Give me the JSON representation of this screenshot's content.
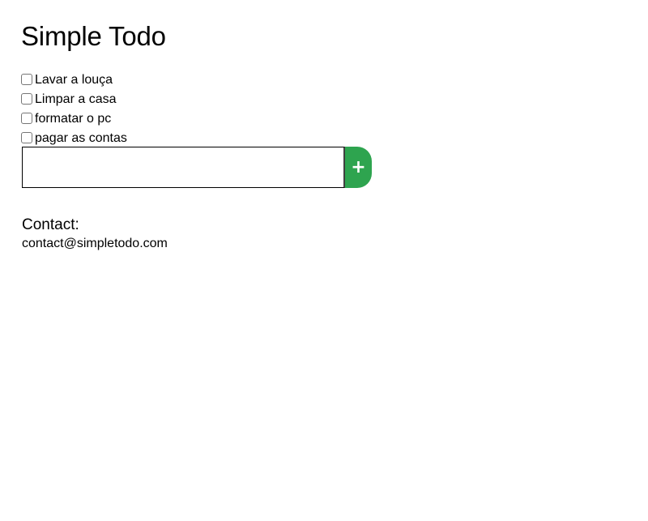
{
  "page": {
    "title": "Simple Todo"
  },
  "todos": [
    {
      "label": "Lavar a louça",
      "checked": false
    },
    {
      "label": "Limpar a casa",
      "checked": false
    },
    {
      "label": "formatar o pc",
      "checked": false
    },
    {
      "label": "pagar as contas",
      "checked": false
    }
  ],
  "new_todo": {
    "value": "",
    "placeholder": "",
    "add_label": "+",
    "add_icon": "plus-icon"
  },
  "contact": {
    "heading": "Contact:",
    "email": "contact@simpletodo.com"
  },
  "colors": {
    "accent": "#2ea44f",
    "text": "#000000",
    "background": "#ffffff"
  }
}
